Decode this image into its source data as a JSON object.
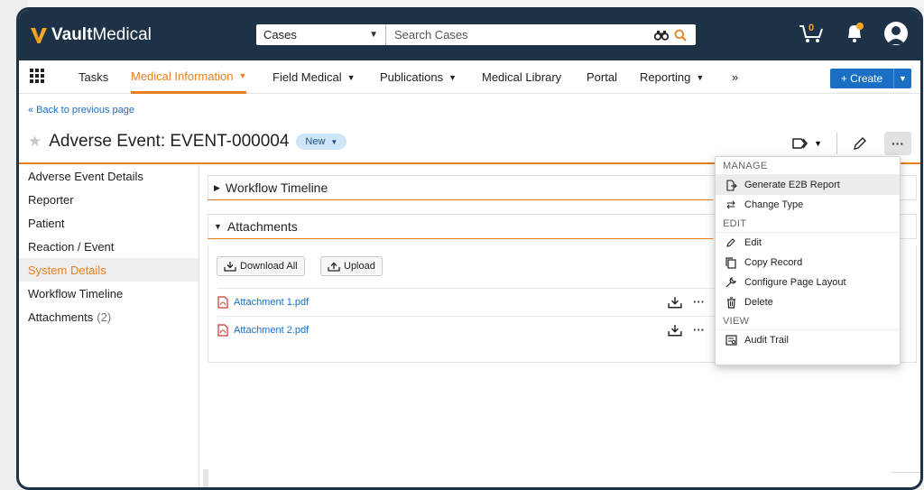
{
  "app": {
    "brand_bold": "Vault",
    "brand_light": "Medical"
  },
  "search": {
    "scope": "Cases",
    "placeholder": "Search Cases"
  },
  "topbar": {
    "cart_count": "0"
  },
  "nav": {
    "items": [
      "Tasks",
      "Medical Information",
      "Field Medical",
      "Publications",
      "Medical Library",
      "Portal",
      "Reporting"
    ],
    "create": "Create"
  },
  "page": {
    "back": "« Back to previous page",
    "title": "Adverse Event: EVENT-000004",
    "status": "New"
  },
  "sidebar": {
    "items": [
      {
        "label": "Adverse Event Details"
      },
      {
        "label": "Reporter"
      },
      {
        "label": "Patient"
      },
      {
        "label": "Reaction / Event"
      },
      {
        "label": "System Details"
      },
      {
        "label": "Workflow Timeline"
      },
      {
        "label": "Attachments",
        "count": "(2)"
      }
    ]
  },
  "sections": {
    "workflow": "Workflow Timeline",
    "attachments": "Attachments"
  },
  "attachments": {
    "download_all": "Download All",
    "upload": "Upload",
    "files": [
      "Attachment 1.pdf",
      "Attachment 2.pdf"
    ]
  },
  "menu": {
    "manage_header": "MANAGE",
    "generate": "Generate E2B Report",
    "change_type": "Change Type",
    "edit_header": "EDIT",
    "edit": "Edit",
    "copy": "Copy Record",
    "configure": "Configure Page Layout",
    "delete": "Delete",
    "view_header": "VIEW",
    "audit": "Audit Trail"
  },
  "colors": {
    "navy": "#1d3147",
    "orange": "#e97f1d",
    "link": "#1a6fc4",
    "logo_v": "#f5a623"
  }
}
